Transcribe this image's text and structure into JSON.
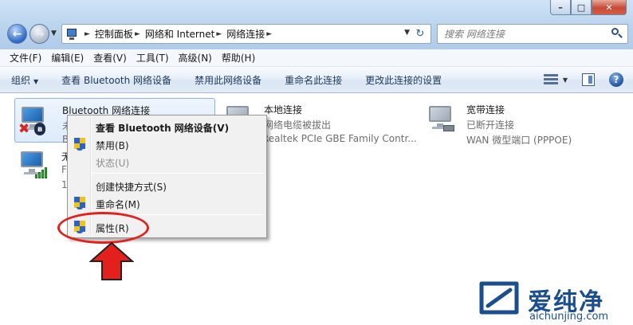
{
  "window": {
    "controls": [
      "–",
      "□",
      "✕"
    ]
  },
  "address_bar": {
    "crumbs": [
      "控制面板",
      "网络和 Internet",
      "网络连接"
    ]
  },
  "search": {
    "placeholder": "搜索 网络连接"
  },
  "menu": [
    "文件(F)",
    "编辑(E)",
    "查看(V)",
    "工具(T)",
    "高级(N)",
    "帮助(H)"
  ],
  "commands": {
    "organize": "组织",
    "view_bluetooth": "查看 Bluetooth 网络设备",
    "disable": "禁用此网络设备",
    "rename": "重命名此连接",
    "change_settings": "更改此连接的设置",
    "help": "?"
  },
  "connections": [
    {
      "name": "Bluetooth 网络连接",
      "line1": "未",
      "line2": "B",
      "icon": "bluetooth-pc-icon",
      "selected": true
    },
    {
      "name": "无",
      "line1": "F",
      "line2": "1",
      "icon": "wireless-pc-icon"
    },
    {
      "name": "本地连接",
      "line1": "网络电缆被拔出",
      "line2": "Realtek PCIe GBE Family Contr...",
      "icon": "lan-pc-icon"
    },
    {
      "name": "宽带连接",
      "line1": "已断开连接",
      "line2": "WAN 微型端口 (PPPOE)",
      "icon": "wan-pc-icon"
    }
  ],
  "context_menu": {
    "items": [
      {
        "label": "查看 Bluetooth 网络设备(V)",
        "bold": true,
        "shield": false
      },
      {
        "label": "禁用(B)",
        "shield": true
      },
      {
        "label": "状态(U)",
        "disabled": true,
        "shield": false
      },
      {
        "label": "创建快捷方式(S)",
        "shield": false
      },
      {
        "label": "重命名(M)",
        "shield": true
      },
      {
        "label": "属性(R)",
        "shield": true
      }
    ]
  },
  "annotation": {
    "highlight_color": "#e3201b",
    "target": "属性(R)"
  },
  "watermark": {
    "title": "爱纯净",
    "url": "aichunjing.com"
  },
  "colors": {
    "accent": "#1e395b",
    "selection": "#dcebfc",
    "annotation": "#e3201b",
    "watermark": "#1a4e8f"
  }
}
